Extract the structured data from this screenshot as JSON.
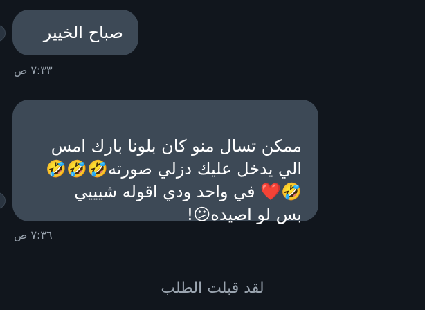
{
  "messages": [
    {
      "text": "صباح الخيير",
      "time": "٧:٣٣ ص"
    },
    {
      "text": "ممكن تسال منو كان بلونا بارك امس\nالي يدخل عليك دزلي صورته🤣🤣🤣\n🤣❤️ في واحد ودي اقوله شيييي\nبس لو اصيده😕!",
      "time": "٧:٣٦ ص"
    }
  ],
  "system_message": "لقد قبلت الطلب",
  "colors": {
    "background": "#11161d",
    "bubble": "#3d4956",
    "timestamp": "#9aa4af"
  }
}
